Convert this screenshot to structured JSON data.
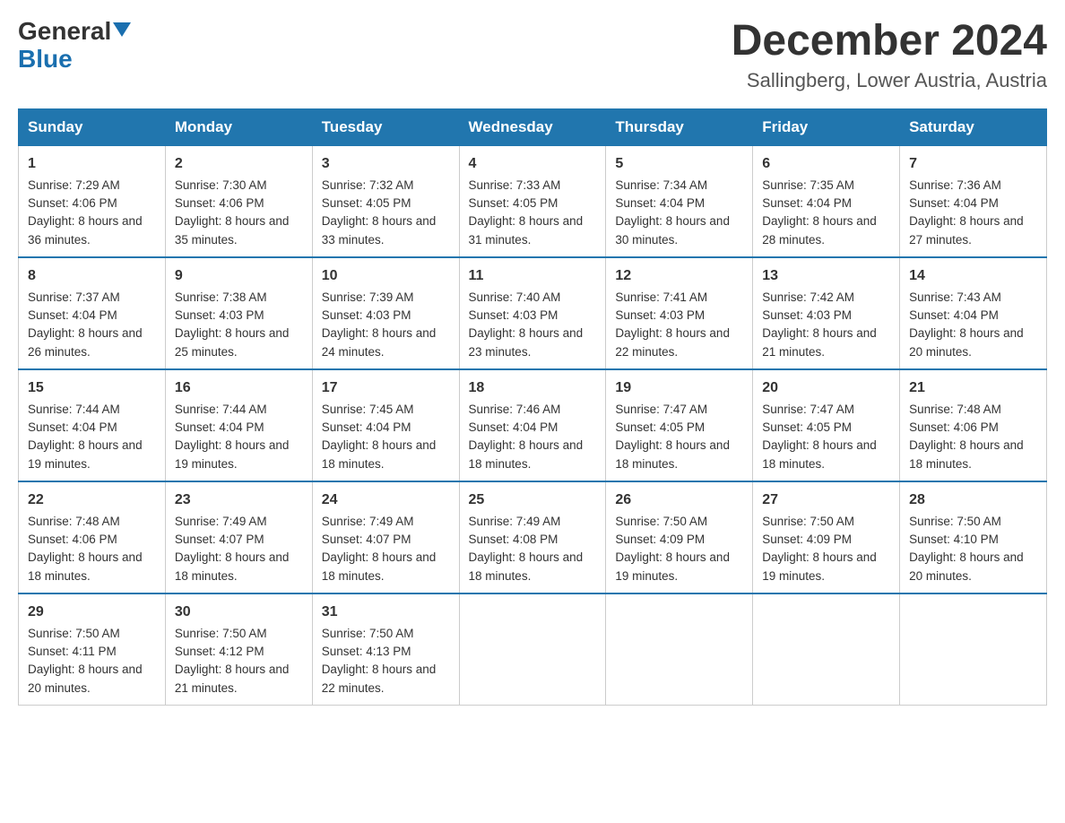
{
  "header": {
    "logo_general": "General",
    "logo_blue": "Blue",
    "month_title": "December 2024",
    "location": "Sallingberg, Lower Austria, Austria"
  },
  "days_of_week": [
    "Sunday",
    "Monday",
    "Tuesday",
    "Wednesday",
    "Thursday",
    "Friday",
    "Saturday"
  ],
  "weeks": [
    [
      {
        "day": 1,
        "sunrise": "7:29 AM",
        "sunset": "4:06 PM",
        "daylight": "8 hours and 36 minutes."
      },
      {
        "day": 2,
        "sunrise": "7:30 AM",
        "sunset": "4:06 PM",
        "daylight": "8 hours and 35 minutes."
      },
      {
        "day": 3,
        "sunrise": "7:32 AM",
        "sunset": "4:05 PM",
        "daylight": "8 hours and 33 minutes."
      },
      {
        "day": 4,
        "sunrise": "7:33 AM",
        "sunset": "4:05 PM",
        "daylight": "8 hours and 31 minutes."
      },
      {
        "day": 5,
        "sunrise": "7:34 AM",
        "sunset": "4:04 PM",
        "daylight": "8 hours and 30 minutes."
      },
      {
        "day": 6,
        "sunrise": "7:35 AM",
        "sunset": "4:04 PM",
        "daylight": "8 hours and 28 minutes."
      },
      {
        "day": 7,
        "sunrise": "7:36 AM",
        "sunset": "4:04 PM",
        "daylight": "8 hours and 27 minutes."
      }
    ],
    [
      {
        "day": 8,
        "sunrise": "7:37 AM",
        "sunset": "4:04 PM",
        "daylight": "8 hours and 26 minutes."
      },
      {
        "day": 9,
        "sunrise": "7:38 AM",
        "sunset": "4:03 PM",
        "daylight": "8 hours and 25 minutes."
      },
      {
        "day": 10,
        "sunrise": "7:39 AM",
        "sunset": "4:03 PM",
        "daylight": "8 hours and 24 minutes."
      },
      {
        "day": 11,
        "sunrise": "7:40 AM",
        "sunset": "4:03 PM",
        "daylight": "8 hours and 23 minutes."
      },
      {
        "day": 12,
        "sunrise": "7:41 AM",
        "sunset": "4:03 PM",
        "daylight": "8 hours and 22 minutes."
      },
      {
        "day": 13,
        "sunrise": "7:42 AM",
        "sunset": "4:03 PM",
        "daylight": "8 hours and 21 minutes."
      },
      {
        "day": 14,
        "sunrise": "7:43 AM",
        "sunset": "4:04 PM",
        "daylight": "8 hours and 20 minutes."
      }
    ],
    [
      {
        "day": 15,
        "sunrise": "7:44 AM",
        "sunset": "4:04 PM",
        "daylight": "8 hours and 19 minutes."
      },
      {
        "day": 16,
        "sunrise": "7:44 AM",
        "sunset": "4:04 PM",
        "daylight": "8 hours and 19 minutes."
      },
      {
        "day": 17,
        "sunrise": "7:45 AM",
        "sunset": "4:04 PM",
        "daylight": "8 hours and 18 minutes."
      },
      {
        "day": 18,
        "sunrise": "7:46 AM",
        "sunset": "4:04 PM",
        "daylight": "8 hours and 18 minutes."
      },
      {
        "day": 19,
        "sunrise": "7:47 AM",
        "sunset": "4:05 PM",
        "daylight": "8 hours and 18 minutes."
      },
      {
        "day": 20,
        "sunrise": "7:47 AM",
        "sunset": "4:05 PM",
        "daylight": "8 hours and 18 minutes."
      },
      {
        "day": 21,
        "sunrise": "7:48 AM",
        "sunset": "4:06 PM",
        "daylight": "8 hours and 18 minutes."
      }
    ],
    [
      {
        "day": 22,
        "sunrise": "7:48 AM",
        "sunset": "4:06 PM",
        "daylight": "8 hours and 18 minutes."
      },
      {
        "day": 23,
        "sunrise": "7:49 AM",
        "sunset": "4:07 PM",
        "daylight": "8 hours and 18 minutes."
      },
      {
        "day": 24,
        "sunrise": "7:49 AM",
        "sunset": "4:07 PM",
        "daylight": "8 hours and 18 minutes."
      },
      {
        "day": 25,
        "sunrise": "7:49 AM",
        "sunset": "4:08 PM",
        "daylight": "8 hours and 18 minutes."
      },
      {
        "day": 26,
        "sunrise": "7:50 AM",
        "sunset": "4:09 PM",
        "daylight": "8 hours and 19 minutes."
      },
      {
        "day": 27,
        "sunrise": "7:50 AM",
        "sunset": "4:09 PM",
        "daylight": "8 hours and 19 minutes."
      },
      {
        "day": 28,
        "sunrise": "7:50 AM",
        "sunset": "4:10 PM",
        "daylight": "8 hours and 20 minutes."
      }
    ],
    [
      {
        "day": 29,
        "sunrise": "7:50 AM",
        "sunset": "4:11 PM",
        "daylight": "8 hours and 20 minutes."
      },
      {
        "day": 30,
        "sunrise": "7:50 AM",
        "sunset": "4:12 PM",
        "daylight": "8 hours and 21 minutes."
      },
      {
        "day": 31,
        "sunrise": "7:50 AM",
        "sunset": "4:13 PM",
        "daylight": "8 hours and 22 minutes."
      },
      null,
      null,
      null,
      null
    ]
  ]
}
